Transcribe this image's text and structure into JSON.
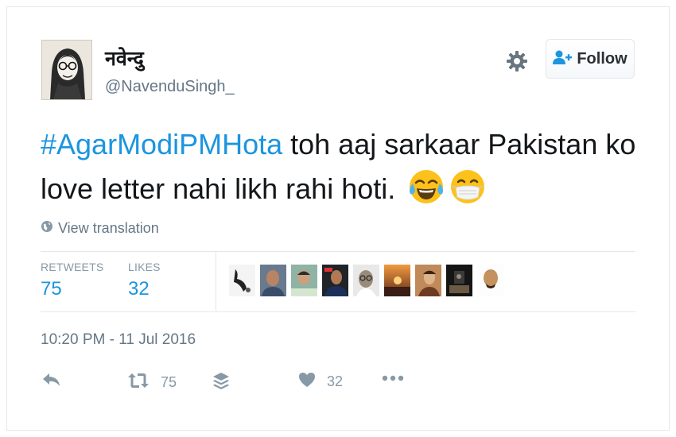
{
  "user": {
    "display_name": "नवेन्दु",
    "handle": "@NavenduSingh_"
  },
  "header": {
    "follow_label": "Follow",
    "settings_icon": "gear-icon",
    "follow_icon": "add-user-icon"
  },
  "tweet": {
    "hashtag": "#AgarModiPMHota",
    "text_line1": " toh aaj sarkaar Pakistan ko",
    "text_line2": "love letter nahi likh rahi hoti.",
    "emojis": [
      "face-with-tears-of-joy",
      "face-with-medical-mask"
    ]
  },
  "translation": {
    "label": "View translation",
    "icon": "globe-icon"
  },
  "stats": {
    "retweets_label": "RETWEETS",
    "retweets_value": "75",
    "likes_label": "LIKES",
    "likes_value": "32"
  },
  "timestamp": "10:20 PM - 11 Jul 2016",
  "actions": {
    "reply_icon": "reply-icon",
    "retweet_icon": "retweet-icon",
    "retweet_count": "75",
    "buffer_icon": "stack-icon",
    "like_icon": "heart-icon",
    "like_count": "32",
    "more_icon": "more-icon"
  },
  "colors": {
    "link_blue": "#1b95e0",
    "muted_gray": "#657786",
    "icon_gray": "#8899a6",
    "border": "#e1e8ed"
  }
}
